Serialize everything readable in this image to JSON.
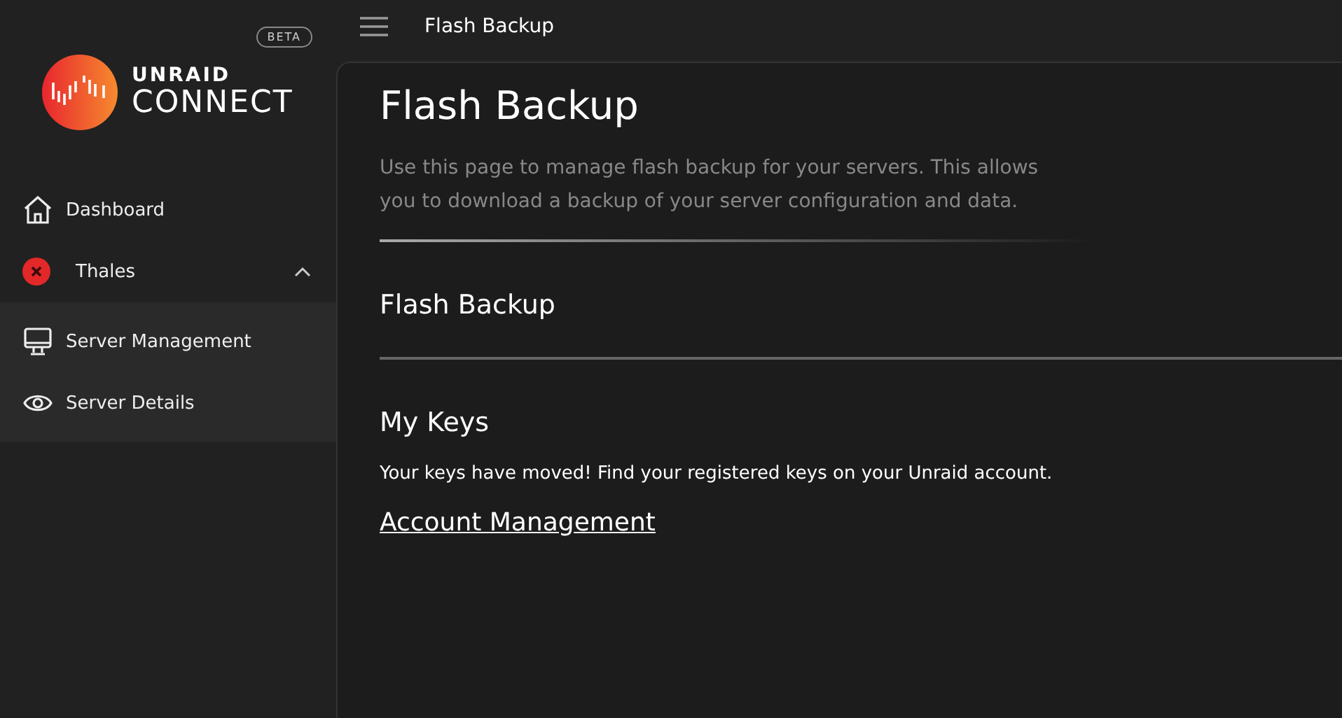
{
  "logo": {
    "line_1": "UNRAID",
    "line_2": "CONNECT",
    "badge": "BETA"
  },
  "sidebar": {
    "items": [
      {
        "label": "Dashboard"
      }
    ],
    "server": {
      "name": "Thales",
      "online": false,
      "expanded": true,
      "children": [
        {
          "label": "Server Management",
          "kind": "monitor"
        },
        {
          "label": "Server Details",
          "kind": "eye"
        }
      ]
    }
  },
  "topbar": {
    "title": "Flash Backup"
  },
  "page": {
    "title": "Flash Backup",
    "description": "Use this page to manage flash backup for your servers. This allows you to download a backup of your server configuration and data.",
    "sections": [
      {
        "title": "Flash Backup"
      },
      {
        "title": "My Keys",
        "text": "Your keys have moved! Find your registered keys on your Unraid account.",
        "link": "Account Management"
      }
    ]
  }
}
